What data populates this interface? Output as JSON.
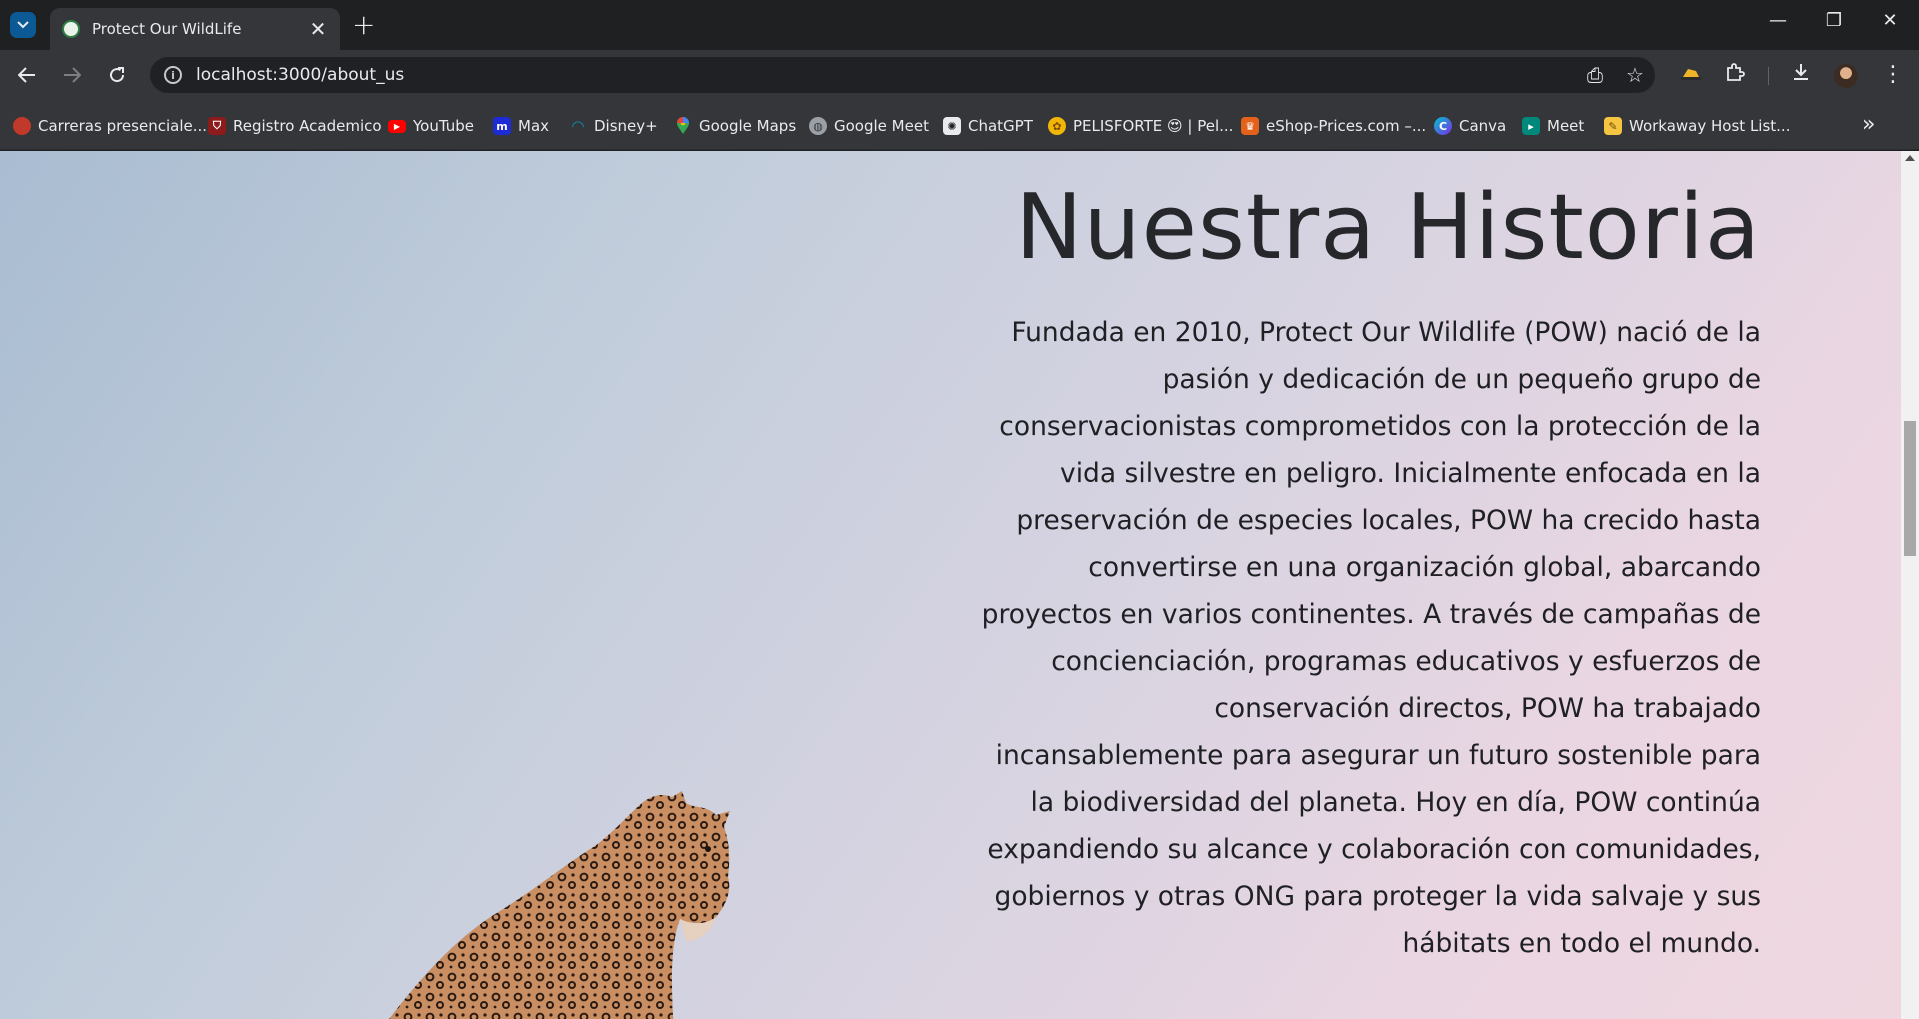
{
  "browser": {
    "tab": {
      "title": "Protect Our WildLife",
      "close_glyph": "✕"
    },
    "new_tab_glyph": "+",
    "window_controls": {
      "minimize": "—",
      "restore": "❐",
      "close": "✕"
    },
    "address_bar": {
      "url": "localhost:3000/about_us"
    },
    "bookmarks": [
      {
        "label": "Carreras presenciale...",
        "icon": "circle-red-icon",
        "color": "#c0392b"
      },
      {
        "label": "Registro Academico",
        "icon": "shield-red-icon",
        "color": "#8e1b1b"
      },
      {
        "label": "YouTube",
        "icon": "youtube-icon",
        "color": "#ff0000"
      },
      {
        "label": "Max",
        "icon": "max-icon",
        "color": "#1d2bd6"
      },
      {
        "label": "Disney+",
        "icon": "disney-icon",
        "color": "#0f6f9e"
      },
      {
        "label": "Google Maps",
        "icon": "maps-pin-icon",
        "color": "#34a853"
      },
      {
        "label": "Google Meet",
        "icon": "globe-icon",
        "color": "#9aa0a6"
      },
      {
        "label": "ChatGPT",
        "icon": "chatgpt-icon",
        "color": "#e8eaed"
      },
      {
        "label": "PELISFORTE 😍 | Pel...",
        "icon": "film-reel-icon",
        "color": "#f2b705"
      },
      {
        "label": "eShop-Prices.com –...",
        "icon": "eshop-icon",
        "color": "#e2621b"
      },
      {
        "label": "Canva",
        "icon": "canva-icon",
        "color": "#00c4cc"
      },
      {
        "label": "Meet",
        "icon": "meet-icon",
        "color": "#00897b"
      },
      {
        "label": "Workaway Host List...",
        "icon": "workaway-icon",
        "color": "#f5c542"
      }
    ]
  },
  "page": {
    "title": "Nuestra Historia",
    "body": "Fundada en 2010, Protect Our Wildlife (POW) nació de la pasión y dedicación de un pequeño grupo de conservacionistas comprometidos con la protección de la vida silvestre en peligro. Inicialmente enfocada en la preservación de especies locales, POW ha crecido hasta convertirse en una organización global, abarcando proyectos en varios continentes. A través de campañas de concienciación, programas educativos y esfuerzos de conservación directos, POW ha trabajado incansablemente para asegurar un futuro sostenible para la biodiversidad del planeta. Hoy en día, POW continúa expandiendo su alcance y colaboración con comunidades, gobiernos y otras ONG para proteger la vida salvaje y sus hábitats en todo el mundo."
  }
}
